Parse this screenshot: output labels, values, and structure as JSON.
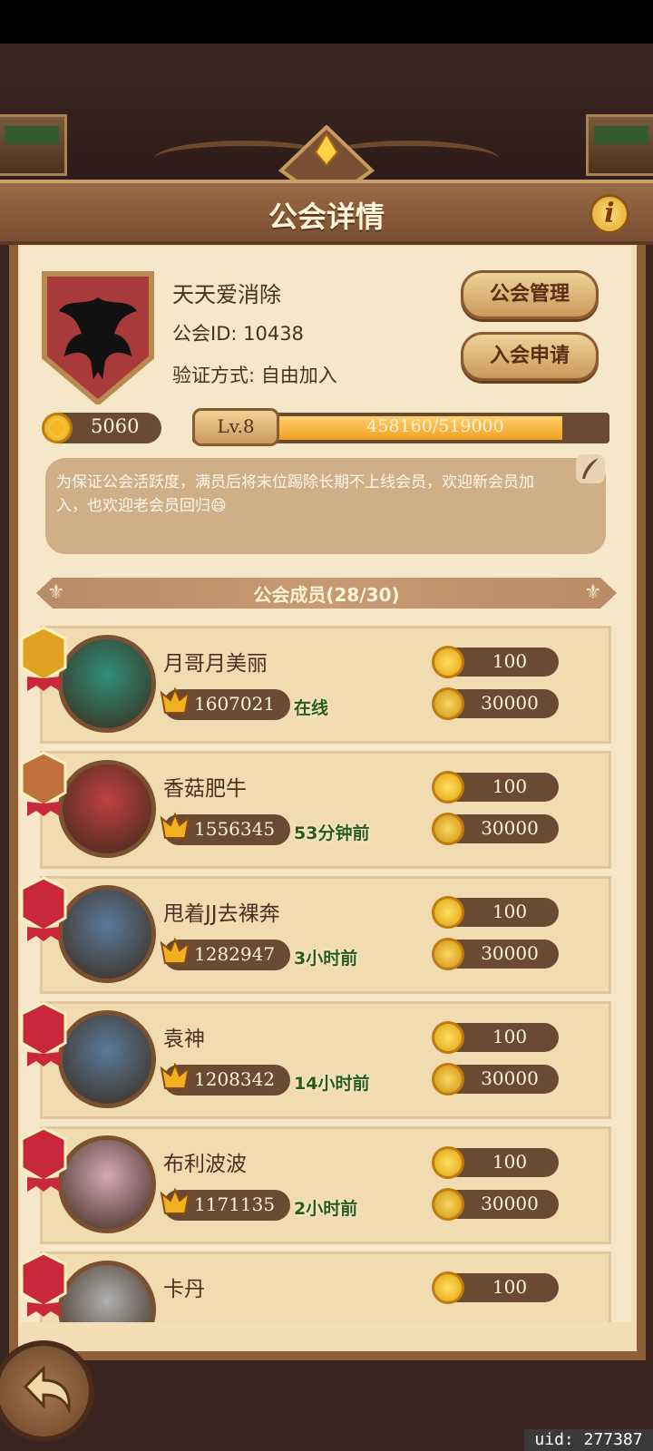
{
  "header": {
    "title": "公会详情",
    "info_icon": "info-icon"
  },
  "guild": {
    "name": "天天爱消除",
    "id_label": "公会ID: 10438",
    "join_label": "验证方式: 自由加入",
    "coins": "5060",
    "level": "Lv.8",
    "exp_text": "458160/519000",
    "exp_fraction": 0.8828,
    "notice": "为保证公会活跃度，满员后将末位踢除长期不上线会员，欢迎新会员加入，也欢迎老会员回归😄"
  },
  "buttons": {
    "manage": "公会管理",
    "apply": "入会申请"
  },
  "members_title": "公会成员(28/30)",
  "members": [
    {
      "name": "月哥月美丽",
      "power": "1607021",
      "status": "在线",
      "coins": "100",
      "contrib": "30000",
      "rank": "gold-crown-badge"
    },
    {
      "name": "香菇肥牛",
      "power": "1556345",
      "status": "53分钟前",
      "coins": "100",
      "contrib": "30000",
      "rank": "bronze-badge"
    },
    {
      "name": "甩着JJ去裸奔",
      "power": "1282947",
      "status": "3小时前",
      "coins": "100",
      "contrib": "30000",
      "rank": "red-swords-badge"
    },
    {
      "name": "袁神",
      "power": "1208342",
      "status": "14小时前",
      "coins": "100",
      "contrib": "30000",
      "rank": "red-swords-badge"
    },
    {
      "name": "布利波波",
      "power": "1171135",
      "status": "2小时前",
      "coins": "100",
      "contrib": "30000",
      "rank": "red-swords-badge"
    },
    {
      "name": "卡丹",
      "power": "",
      "status": "",
      "coins": "100",
      "contrib": "",
      "rank": "red-swords-badge"
    }
  ],
  "uid": "uid: 277387",
  "colors": {
    "frame": "#8f5f3a",
    "parchment": "#f6e7c8",
    "online": "#2c5a12"
  }
}
